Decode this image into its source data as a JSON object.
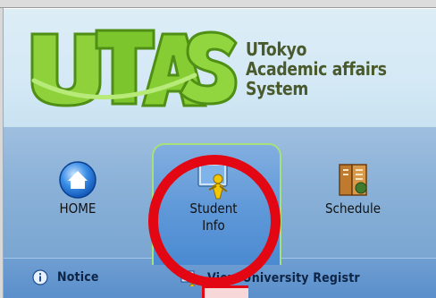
{
  "logo": {
    "mark_text": "UTAS",
    "lines": [
      "UTokyo",
      "Academic affairs",
      "System"
    ],
    "text_color": "#4a5a2c",
    "mark_color": "#7cc52d"
  },
  "tabs": [
    {
      "label": "HOME",
      "icon": "home-globe-icon",
      "active": false
    },
    {
      "label": "Student\nInfo",
      "icon": "student-info-icon",
      "active": true
    },
    {
      "label": "Schedule",
      "icon": "schedule-book-icon",
      "active": false
    }
  ],
  "sub_nav": {
    "items": [
      {
        "label": "Notice",
        "icon": "info-icon"
      },
      {
        "label": "View University Registr",
        "icon": "user-card-icon"
      }
    ]
  },
  "annotation": {
    "color": "#e30613",
    "target": "tab-student-info"
  }
}
